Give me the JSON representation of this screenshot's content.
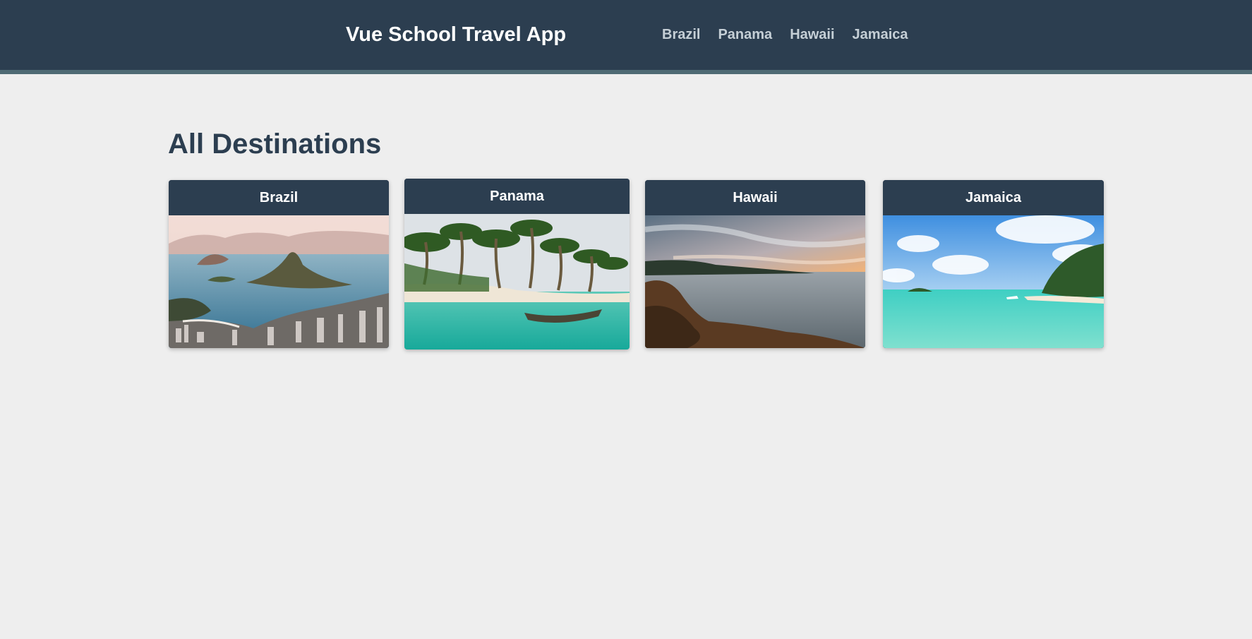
{
  "header": {
    "brand": "Vue School Travel App",
    "nav": [
      {
        "label": "Brazil"
      },
      {
        "label": "Panama"
      },
      {
        "label": "Hawaii"
      },
      {
        "label": "Jamaica"
      }
    ],
    "background_color": "#2c3e50",
    "border_color": "#4e6a73"
  },
  "main": {
    "title": "All Destinations",
    "destinations": [
      {
        "name": "Brazil",
        "image": "rio-de-janeiro-sugarloaf-photo"
      },
      {
        "name": "Panama",
        "image": "palm-beach-canoe-photo"
      },
      {
        "name": "Hawaii",
        "image": "rocky-coast-sunset-photo"
      },
      {
        "name": "Jamaica",
        "image": "turquoise-lagoon-island-photo"
      }
    ]
  },
  "colors": {
    "page_background": "#eeeeee",
    "title_text": "#2c3e50",
    "nav_text": "#c5cfd6",
    "card_header": "#2c3e50"
  }
}
